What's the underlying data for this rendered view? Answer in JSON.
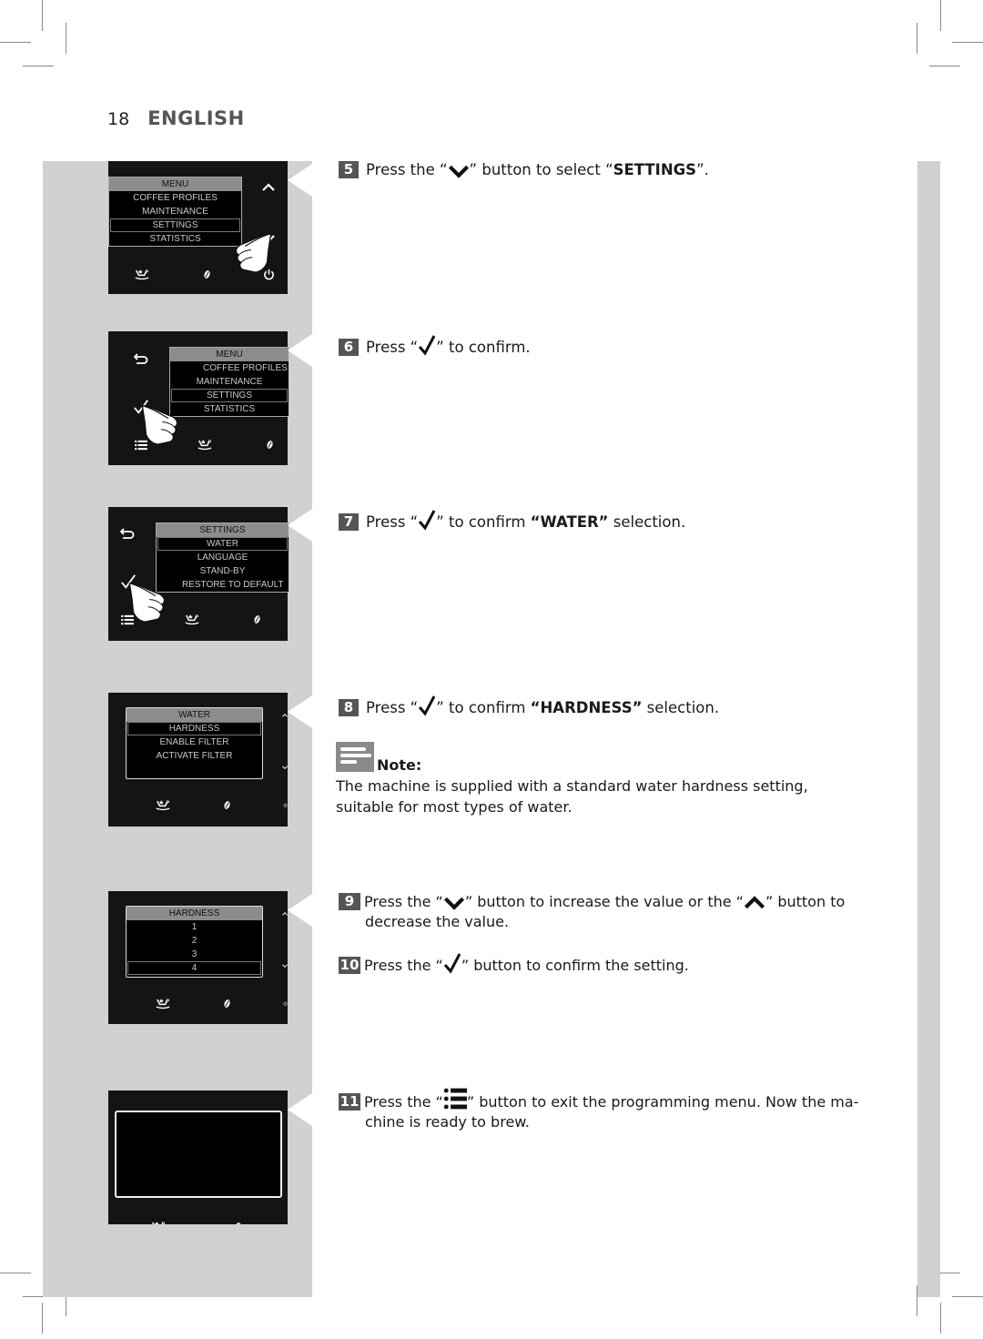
{
  "header": {
    "page_number": "18",
    "language": "ENGLISH"
  },
  "panels": [
    {
      "id": "step5-panel",
      "menu_title": "MENU",
      "items": [
        "COFFEE PROFILES",
        "MAINTENANCE",
        "SETTINGS",
        "STATISTICS"
      ],
      "selected": "SETTINGS",
      "left_icons": [],
      "right_icons": [
        "chevron-up-icon",
        "chevron-down-icon"
      ],
      "bottom_icons": [
        "special-coffee-icon",
        "coffee-bean-icon",
        "power-icon"
      ],
      "hand_pointing_at": "chevron-down-icon"
    },
    {
      "id": "step6-panel",
      "menu_title": "MENU",
      "items": [
        "COFFEE PROFILES",
        "MAINTENANCE",
        "SETTINGS",
        "STATISTICS"
      ],
      "selected": "SETTINGS",
      "left_icons": [
        "back-icon",
        "checkmark-icon"
      ],
      "bottom_icons": [
        "menu-list-icon",
        "special-coffee-icon",
        "coffee-bean-icon"
      ],
      "hand_pointing_at": "checkmark-icon"
    },
    {
      "id": "step7-panel",
      "menu_title": "SETTINGS",
      "items": [
        "WATER",
        "LANGUAGE",
        "STAND-BY",
        "RESTORE TO DEFAULT"
      ],
      "selected": "WATER",
      "left_icons": [
        "back-icon",
        "checkmark-icon"
      ],
      "bottom_icons": [
        "menu-list-icon",
        "special-coffee-icon",
        "coffee-bean-icon"
      ],
      "hand_pointing_at": "checkmark-icon"
    },
    {
      "id": "step8-panel",
      "menu_title": "WATER",
      "items": [
        "HARDNESS",
        "ENABLE FILTER",
        "ACTIVATE FILTER"
      ],
      "selected": "HARDNESS",
      "bottom_icons": [
        "special-coffee-icon",
        "coffee-bean-icon",
        "power-icon"
      ]
    },
    {
      "id": "step9-panel",
      "menu_title": "HARDNESS",
      "items": [
        "1",
        "2",
        "3",
        "4"
      ],
      "selected": "4",
      "bottom_icons": [
        "special-coffee-icon",
        "coffee-bean-icon",
        "power-icon"
      ]
    },
    {
      "id": "step11-panel",
      "menu_title": "",
      "items": [],
      "bottom_icons": [
        "special-coffee-icon",
        "coffee-bean-icon"
      ]
    }
  ],
  "steps": [
    {
      "num": "5",
      "pre": "Press the “",
      "icon": "chevron-down-icon",
      "post": "” button to select “",
      "bold": "SETTINGS",
      "tail": "”."
    },
    {
      "num": "6",
      "pre": "Press “",
      "icon": "checkmark-icon",
      "post": "” to confirm."
    },
    {
      "num": "7",
      "pre": "Press “",
      "icon": "checkmark-icon",
      "post": "” to confirm ",
      "bold": "“WATER”",
      "tail": " selection."
    },
    {
      "num": "8",
      "pre": "Press “",
      "icon": "checkmark-icon",
      "post": "” to confirm ",
      "bold": "“HARDNESS”",
      "tail": " selection."
    },
    {
      "num": "9",
      "pre": "Press the “",
      "icon": "chevron-down-icon",
      "mid": "” button to increase the value or the “",
      "icon2": "chevron-up-icon",
      "post": "” button to",
      "line2": "decrease the value."
    },
    {
      "num": "10",
      "pre": "Press the “",
      "icon": "checkmark-icon",
      "post": "” button to confirm the setting."
    },
    {
      "num": "11",
      "pre": "Press the “",
      "icon": "menu-list-icon",
      "post": "” button to exit the programming menu. Now the ma-",
      "line2": "chine is ready to brew."
    }
  ],
  "note": {
    "title": "Note:",
    "body": "The machine is supplied with a standard water hardness setting, suitable for most types of water."
  }
}
